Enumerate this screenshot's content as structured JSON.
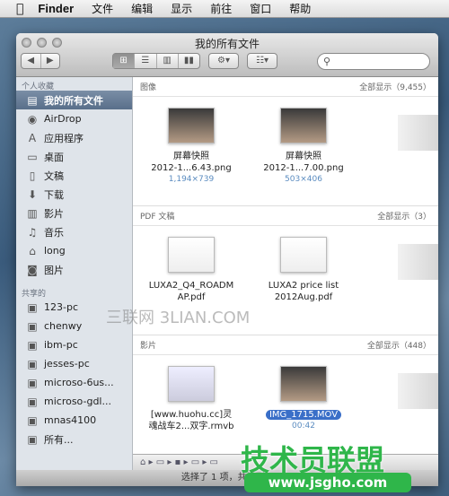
{
  "menubar": {
    "apple": "",
    "app": "Finder",
    "items": [
      "文件",
      "编辑",
      "显示",
      "前往",
      "窗口",
      "帮助"
    ]
  },
  "window": {
    "title": "我的所有文件"
  },
  "toolbar": {
    "back": "◀",
    "forward": "▶",
    "views": [
      "icon-view",
      "list-view",
      "column-view",
      "coverflow-view"
    ],
    "active_view": "icon-view",
    "action": "⚙▾",
    "arrange": "☷▾",
    "search_placeholder": ""
  },
  "sidebar": {
    "favorites_header": "个人收藏",
    "favorites": [
      {
        "label": "我的所有文件",
        "icon": "all-files-icon",
        "glyph": "▤",
        "selected": true
      },
      {
        "label": "AirDrop",
        "icon": "airdrop-icon",
        "glyph": "◉"
      },
      {
        "label": "应用程序",
        "icon": "applications-icon",
        "glyph": "A"
      },
      {
        "label": "桌面",
        "icon": "desktop-icon",
        "glyph": "▭"
      },
      {
        "label": "文稿",
        "icon": "documents-icon",
        "glyph": "▯"
      },
      {
        "label": "下载",
        "icon": "downloads-icon",
        "glyph": "⬇"
      },
      {
        "label": "影片",
        "icon": "movies-icon",
        "glyph": "▥"
      },
      {
        "label": "音乐",
        "icon": "music-icon",
        "glyph": "♫"
      },
      {
        "label": "long",
        "icon": "home-icon",
        "glyph": "⌂"
      },
      {
        "label": "图片",
        "icon": "pictures-icon",
        "glyph": "◙"
      }
    ],
    "shared_header": "共享的",
    "shared": [
      {
        "label": "123-pc",
        "icon": "computer-icon"
      },
      {
        "label": "chenwy",
        "icon": "computer-icon"
      },
      {
        "label": "ibm-pc",
        "icon": "computer-icon"
      },
      {
        "label": "jesses-pc",
        "icon": "computer-icon"
      },
      {
        "label": "microso-6us...",
        "icon": "computer-icon"
      },
      {
        "label": "microso-gdl...",
        "icon": "computer-icon"
      },
      {
        "label": "mnas4100",
        "icon": "computer-icon"
      },
      {
        "label": "所有...",
        "icon": "network-icon"
      }
    ]
  },
  "sections": [
    {
      "title": "图像",
      "show_all": "全部显示（9,455）",
      "items": [
        {
          "name1": "屏幕快照",
          "name2": "2012-1...6.43.png",
          "sub": "1,194×739"
        },
        {
          "name1": "屏幕快照",
          "name2": "2012-1...7.00.png",
          "sub": "503×406"
        }
      ]
    },
    {
      "title": "PDF 文稿",
      "show_all": "全部显示（3）",
      "items": [
        {
          "name1": "LUXA2_Q4_ROADM",
          "name2": "AP.pdf",
          "sub": ""
        },
        {
          "name1": "LUXA2 price list",
          "name2": "2012Aug.pdf",
          "sub": ""
        }
      ]
    },
    {
      "title": "影片",
      "show_all": "全部显示（448）",
      "items": [
        {
          "name1": "[www.huohu.cc]灵",
          "name2": "魂战车2...双字.rmvb",
          "sub": ""
        },
        {
          "name1": "IMG_1715.MOV",
          "name2": "",
          "sub": "00:42",
          "selected": true
        }
      ]
    }
  ],
  "pathbar": "⌂ ▸ ▭ ▸ ▪ ▸ ▭ ▸ ▭",
  "status": "选择了 1 项，共找到 1",
  "watermarks": {
    "a": "三联网 3LIAN.COM",
    "b": "技术员联盟",
    "c": "www.jsgho.com"
  }
}
